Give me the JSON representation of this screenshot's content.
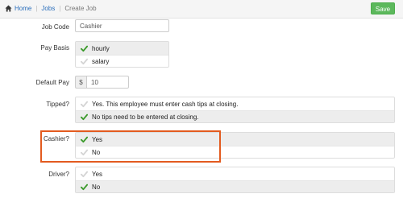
{
  "breadcrumb": {
    "home": "Home",
    "jobs": "Jobs",
    "current": "Create Job"
  },
  "toolbar": {
    "save_label": "Save"
  },
  "form": {
    "job_code": {
      "label": "Job Code",
      "value": "Cashier"
    },
    "pay_basis": {
      "label": "Pay Basis",
      "options": [
        "hourly",
        "salary"
      ],
      "selected": "hourly"
    },
    "default_pay": {
      "label": "Default Pay",
      "currency": "$",
      "value": "10"
    },
    "tipped": {
      "label": "Tipped?",
      "options": [
        "Yes. This employee must enter cash tips at closing.",
        "No tips need to be entered at closing."
      ],
      "selected": "No tips need to be entered at closing."
    },
    "cashier": {
      "label": "Cashier?",
      "options": [
        "Yes",
        "No"
      ],
      "selected": "Yes"
    },
    "driver": {
      "label": "Driver?",
      "options": [
        "Yes",
        "No"
      ],
      "selected": "No"
    }
  },
  "colors": {
    "accent": "#2a6ebb",
    "save": "#5cb85c",
    "check": "#3a9a2a",
    "highlight": "#e35b1f"
  }
}
